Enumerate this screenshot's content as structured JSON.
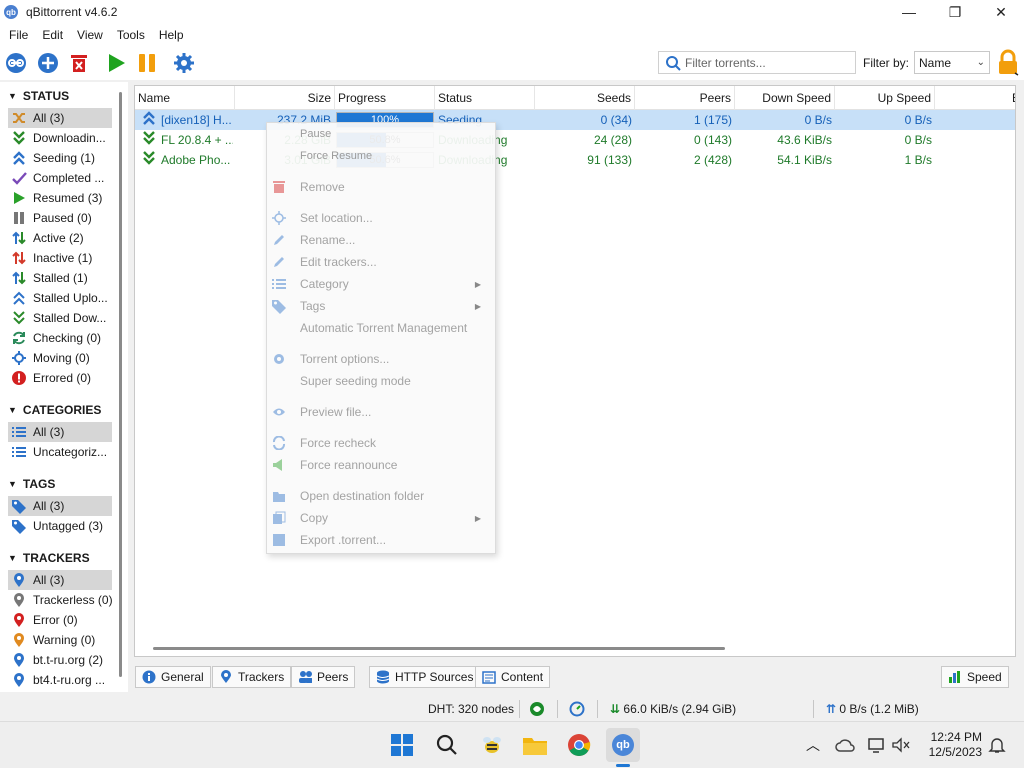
{
  "window": {
    "title": "qBittorrent v4.6.2",
    "app_icon_text": "qb",
    "min": "—",
    "max": "❐",
    "close": "✕"
  },
  "menu": [
    "File",
    "Edit",
    "View",
    "Tools",
    "Help"
  ],
  "toolbar": {
    "buttons": [
      "resume-all-icon",
      "add-torrent-icon",
      "delete-icon",
      "start-icon",
      "pause-icon",
      "options-icon"
    ],
    "search_placeholder": "Filter torrents...",
    "filter_label": "Filter by:",
    "filter_value": "Name"
  },
  "sidebar": {
    "status_title": "STATUS",
    "status_items": [
      {
        "label": "All (3)",
        "icon": "all-icon",
        "color": "#d08b2a"
      },
      {
        "label": "Downloadin...",
        "icon": "downloading-icon",
        "color": "#2a8a2a"
      },
      {
        "label": "Seeding (1)",
        "icon": "seeding-icon",
        "color": "#2d72c9"
      },
      {
        "label": "Completed ...",
        "icon": "check-icon",
        "color": "#7a4ab8"
      },
      {
        "label": "Resumed (3)",
        "icon": "play-icon",
        "color": "#2aa12a"
      },
      {
        "label": "Paused (0)",
        "icon": "pause-icon",
        "color": "#777777"
      },
      {
        "label": "Active (2)",
        "icon": "active-icon",
        "color": "#2a8a2a"
      },
      {
        "label": "Inactive (1)",
        "icon": "inactive-icon",
        "color": "#d33a2a"
      },
      {
        "label": "Stalled (1)",
        "icon": "stalled-icon",
        "color": "#2d72c9"
      },
      {
        "label": "Stalled Uplo...",
        "icon": "stalled-up-icon",
        "color": "#2d72c9"
      },
      {
        "label": "Stalled Dow...",
        "icon": "stalled-down-icon",
        "color": "#2a8a2a"
      },
      {
        "label": "Checking (0)",
        "icon": "checking-icon",
        "color": "#2a8a5a"
      },
      {
        "label": "Moving (0)",
        "icon": "moving-icon",
        "color": "#2d72c9"
      },
      {
        "label": "Errored (0)",
        "icon": "error-icon",
        "color": "#d32020"
      }
    ],
    "categories_title": "CATEGORIES",
    "category_items": [
      {
        "label": "All (3)",
        "icon": "list-icon"
      },
      {
        "label": "Uncategoriz...",
        "icon": "list-icon"
      }
    ],
    "tags_title": "TAGS",
    "tag_items": [
      {
        "label": "All (3)",
        "icon": "tag-icon"
      },
      {
        "label": "Untagged (3)",
        "icon": "tag-icon"
      }
    ],
    "trackers_title": "TRACKERS",
    "tracker_items": [
      {
        "label": "All (3)",
        "icon": "pin-icon",
        "color": "#2d72c9"
      },
      {
        "label": "Trackerless (0)",
        "icon": "pin-icon",
        "color": "#777777"
      },
      {
        "label": "Error (0)",
        "icon": "pin-icon",
        "color": "#d32020"
      },
      {
        "label": "Warning (0)",
        "icon": "pin-icon",
        "color": "#e08a20"
      },
      {
        "label": "bt.t-ru.org (2)",
        "icon": "pin-icon",
        "color": "#2d72c9"
      },
      {
        "label": "bt4.t-ru.org ...",
        "icon": "pin-icon",
        "color": "#2d72c9"
      }
    ]
  },
  "table": {
    "headers": [
      "Name",
      "Size",
      "Progress",
      "Status",
      "Seeds",
      "Peers",
      "Down Speed",
      "Up Speed",
      "E"
    ],
    "rows": [
      {
        "name": "[dixen18] H...",
        "size": "237.2 MiB",
        "progress": "100%",
        "progress_value": 1.0,
        "status": "Seeding",
        "seeds": "0 (34)",
        "peers": "1 (175)",
        "down": "0 B/s",
        "up": "0 B/s",
        "icon": "seeding-icon"
      },
      {
        "name": "FL 20.8.4 + ...",
        "size": "2.28 GiB",
        "progress": "50.8%",
        "progress_value": 0.508,
        "status": "Downloading",
        "seeds": "24 (28)",
        "peers": "0 (143)",
        "down": "43.6 KiB/s",
        "up": "0 B/s",
        "icon": "downloading-icon"
      },
      {
        "name": "Adobe Pho...",
        "size": "3.01 GiB",
        "progress": "50.6%",
        "progress_value": 0.506,
        "status": "Downloading",
        "seeds": "91 (133)",
        "peers": "2 (428)",
        "down": "54.1 KiB/s",
        "up": "1 B/s",
        "icon": "downloading-icon"
      }
    ]
  },
  "context_menu": {
    "pause": "Pause",
    "force_resume": "Force Resume",
    "items": [
      {
        "label": "Remove",
        "icon": "delete-icon"
      },
      {
        "label": "Set location...",
        "icon": "location-icon"
      },
      {
        "label": "Rename...",
        "icon": "rename-icon"
      },
      {
        "label": "Edit trackers...",
        "icon": "edit-icon"
      },
      {
        "label": "Category",
        "icon": "category-icon",
        "submenu": true
      },
      {
        "label": "Tags",
        "icon": "tag-icon",
        "submenu": true
      },
      {
        "label": "Automatic Torrent Management",
        "icon": ""
      },
      {
        "label": "Torrent options...",
        "icon": "gear-icon"
      },
      {
        "label": "Super seeding mode",
        "icon": ""
      },
      {
        "label": "Preview file...",
        "icon": "eye-icon"
      },
      {
        "label": "Force recheck",
        "icon": "recheck-icon"
      },
      {
        "label": "Force reannounce",
        "icon": "reannounce-icon"
      },
      {
        "label": "Open destination folder",
        "icon": "folder-icon"
      },
      {
        "label": "Copy",
        "icon": "copy-icon",
        "submenu": true
      },
      {
        "label": "Export .torrent...",
        "icon": "export-icon"
      }
    ]
  },
  "bottom_tabs": [
    "General",
    "Trackers",
    "Peers",
    "HTTP Sources",
    "Content"
  ],
  "speed_tab": "Speed",
  "statusbar": {
    "dht": "DHT: 320 nodes",
    "download": "66.0 KiB/s (2.94 GiB)",
    "upload": "0 B/s (1.2 MiB)"
  },
  "taskbar": {
    "time": "12:24 PM",
    "date": "12/5/2023",
    "qb_text": "qb"
  }
}
